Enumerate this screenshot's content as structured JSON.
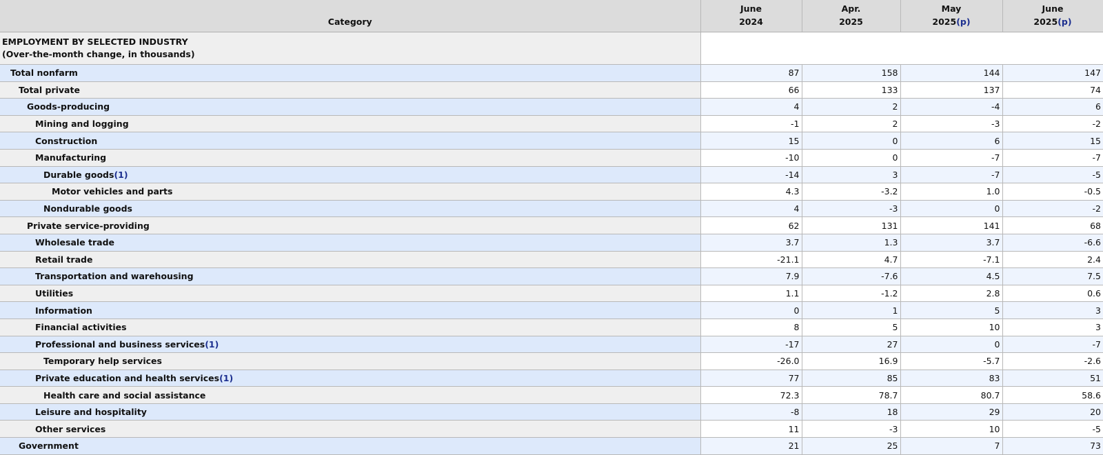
{
  "table": {
    "headers": {
      "category": "Category",
      "col1": {
        "month": "June",
        "year": "2024",
        "note": ""
      },
      "col2": {
        "month": "Apr.",
        "year": "2025",
        "note": ""
      },
      "col3": {
        "month": "May",
        "year": "2025",
        "note": "(p)"
      },
      "col4": {
        "month": "June",
        "year": "2025",
        "note": "(p)"
      }
    },
    "section": {
      "title": "EMPLOYMENT BY SELECTED INDUSTRY",
      "subtitle": "(Over-the-month change, in thousands)"
    },
    "rows": [
      {
        "label": "Total nonfarm",
        "note": "",
        "values": [
          "87",
          "158",
          "144",
          "147"
        ]
      },
      {
        "label": "Total private",
        "note": "",
        "values": [
          "66",
          "133",
          "137",
          "74"
        ]
      },
      {
        "label": "Goods-producing",
        "note": "",
        "values": [
          "4",
          "2",
          "-4",
          "6"
        ]
      },
      {
        "label": "Mining and logging",
        "note": "",
        "values": [
          "-1",
          "2",
          "-3",
          "-2"
        ]
      },
      {
        "label": "Construction",
        "note": "",
        "values": [
          "15",
          "0",
          "6",
          "15"
        ]
      },
      {
        "label": "Manufacturing",
        "note": "",
        "values": [
          "-10",
          "0",
          "-7",
          "-7"
        ]
      },
      {
        "label": "Durable goods",
        "note": "(1)",
        "values": [
          "-14",
          "3",
          "-7",
          "-5"
        ]
      },
      {
        "label": "Motor vehicles and parts",
        "note": "",
        "values": [
          "4.3",
          "-3.2",
          "1.0",
          "-0.5"
        ]
      },
      {
        "label": "Nondurable goods",
        "note": "",
        "values": [
          "4",
          "-3",
          "0",
          "-2"
        ]
      },
      {
        "label": "Private service-providing",
        "note": "",
        "values": [
          "62",
          "131",
          "141",
          "68"
        ]
      },
      {
        "label": "Wholesale trade",
        "note": "",
        "values": [
          "3.7",
          "1.3",
          "3.7",
          "-6.6"
        ]
      },
      {
        "label": "Retail trade",
        "note": "",
        "values": [
          "-21.1",
          "4.7",
          "-7.1",
          "2.4"
        ]
      },
      {
        "label": "Transportation and warehousing",
        "note": "",
        "values": [
          "7.9",
          "-7.6",
          "4.5",
          "7.5"
        ]
      },
      {
        "label": "Utilities",
        "note": "",
        "values": [
          "1.1",
          "-1.2",
          "2.8",
          "0.6"
        ]
      },
      {
        "label": "Information",
        "note": "",
        "values": [
          "0",
          "1",
          "5",
          "3"
        ]
      },
      {
        "label": "Financial activities",
        "note": "",
        "values": [
          "8",
          "5",
          "10",
          "3"
        ]
      },
      {
        "label": "Professional and business services",
        "note": "(1)",
        "values": [
          "-17",
          "27",
          "0",
          "-7"
        ]
      },
      {
        "label": "Temporary help services",
        "note": "",
        "values": [
          "-26.0",
          "16.9",
          "-5.7",
          "-2.6"
        ]
      },
      {
        "label": "Private education and health services",
        "note": "(1)",
        "values": [
          "77",
          "85",
          "83",
          "51"
        ]
      },
      {
        "label": "Health care and social assistance",
        "note": "",
        "values": [
          "72.3",
          "78.7",
          "80.7",
          "58.6"
        ]
      },
      {
        "label": "Leisure and hospitality",
        "note": "",
        "values": [
          "-8",
          "18",
          "29",
          "20"
        ]
      },
      {
        "label": "Other services",
        "note": "",
        "values": [
          "11",
          "-3",
          "10",
          "-5"
        ]
      },
      {
        "label": "Government",
        "note": "",
        "values": [
          "21",
          "25",
          "7",
          "73"
        ]
      }
    ]
  },
  "colors": {
    "header_bg": "#dcdcdc",
    "row_blue_label": "#dde9fb",
    "row_blue_value": "#eef4fe",
    "row_gray_label": "#efefef",
    "row_gray_value": "#ffffff",
    "footnote_link": "#1c2f8f"
  }
}
